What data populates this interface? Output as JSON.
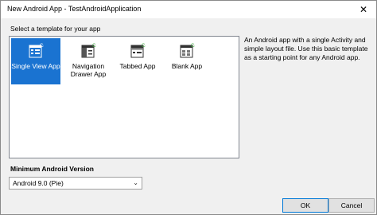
{
  "window": {
    "title": "New Android App - TestAndroidApplication"
  },
  "templates": {
    "section_label": "Select a template for your app",
    "items": [
      {
        "label": "Single View App",
        "selected": true
      },
      {
        "label": "Navigation Drawer App",
        "selected": false
      },
      {
        "label": "Tabbed App",
        "selected": false
      },
      {
        "label": "Blank App",
        "selected": false
      }
    ],
    "description": "An Android app with a single Activity and simple layout file. Use this basic template as a starting point for any Android app."
  },
  "min_version": {
    "label": "Minimum Android Version",
    "selected": "Android 9.0 (Pie)"
  },
  "buttons": {
    "ok": "OK",
    "cancel": "Cancel"
  },
  "colors": {
    "selection": "#1a73d1",
    "icon_accent": "#3aa83a"
  }
}
